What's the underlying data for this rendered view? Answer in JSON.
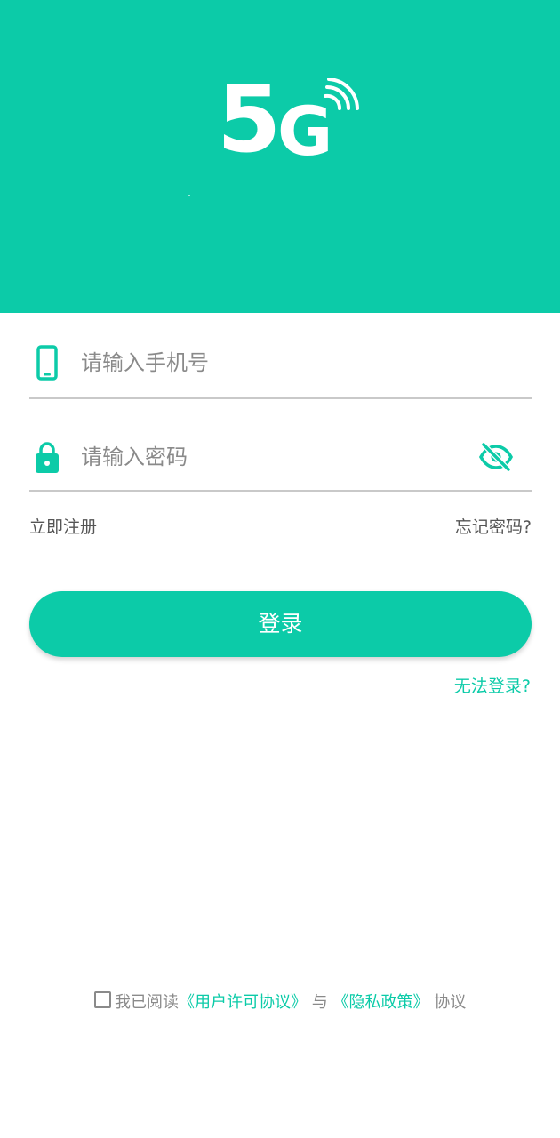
{
  "header": {
    "logo_text_number": "5",
    "logo_text_letter": "G",
    "background_color": "#0ccba8"
  },
  "form": {
    "phone": {
      "placeholder": "请输入手机号",
      "value": "",
      "icon": "phone-icon"
    },
    "password": {
      "placeholder": "请输入密码",
      "value": "",
      "icon": "lock-icon",
      "toggle_icon": "eye-off-icon"
    }
  },
  "links": {
    "register": "立即注册",
    "forgot_password": "忘记密码?"
  },
  "login_button": {
    "label": "登录"
  },
  "cannot_login": "无法登录?",
  "agreement": {
    "checked": false,
    "prefix": "我已阅读",
    "user_agreement": "《用户许可协议》",
    "conjunction": "与",
    "privacy_policy": "《隐私政策》",
    "suffix": "协议"
  },
  "colors": {
    "accent": "#0ccba8",
    "text_gray": "#8a8a8a",
    "divider": "#c9c9c9"
  }
}
